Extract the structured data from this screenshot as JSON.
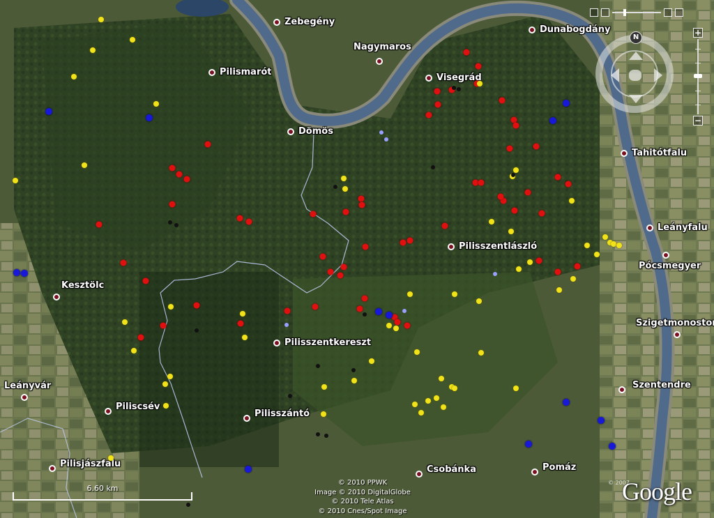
{
  "map": {
    "places": [
      {
        "name": "Zebegény"
      },
      {
        "name": "Dunabogdány"
      },
      {
        "name": "Nagymaros"
      },
      {
        "name": "Pilismarót"
      },
      {
        "name": "Visegrád"
      },
      {
        "name": "Dömös"
      },
      {
        "name": "Tahitótfalu"
      },
      {
        "name": "Leányfalu"
      },
      {
        "name": "Pilisszentlászló"
      },
      {
        "name": "Pócsmegyer"
      },
      {
        "name": "Kesztölc"
      },
      {
        "name": "Szigetmonostor"
      },
      {
        "name": "Pilisszentkereszt"
      },
      {
        "name": "Leányvár"
      },
      {
        "name": "Szentendre"
      },
      {
        "name": "Piliscsév"
      },
      {
        "name": "Pilisszántó"
      },
      {
        "name": "Pilisjászfalu"
      },
      {
        "name": "Csobánka"
      },
      {
        "name": "Pomáz"
      }
    ],
    "marker_colors": {
      "red": "#e01010",
      "yellow": "#f2e21a",
      "blue": "#1818d8",
      "black": "#111111",
      "star": "#9aa0ff"
    }
  },
  "navigation": {
    "north_label": "N",
    "zoom_in_label": "+",
    "zoom_out_label": "−"
  },
  "scale": {
    "label": "6.60 km"
  },
  "attribution": {
    "lines": [
      "© 2010 PPWK",
      "Image © 2010 DigitalGlobe",
      "© 2010 Tele Atlas",
      "© 2010 Cnes/Spot Image"
    ],
    "small": "© 2007"
  },
  "logo": "Google"
}
